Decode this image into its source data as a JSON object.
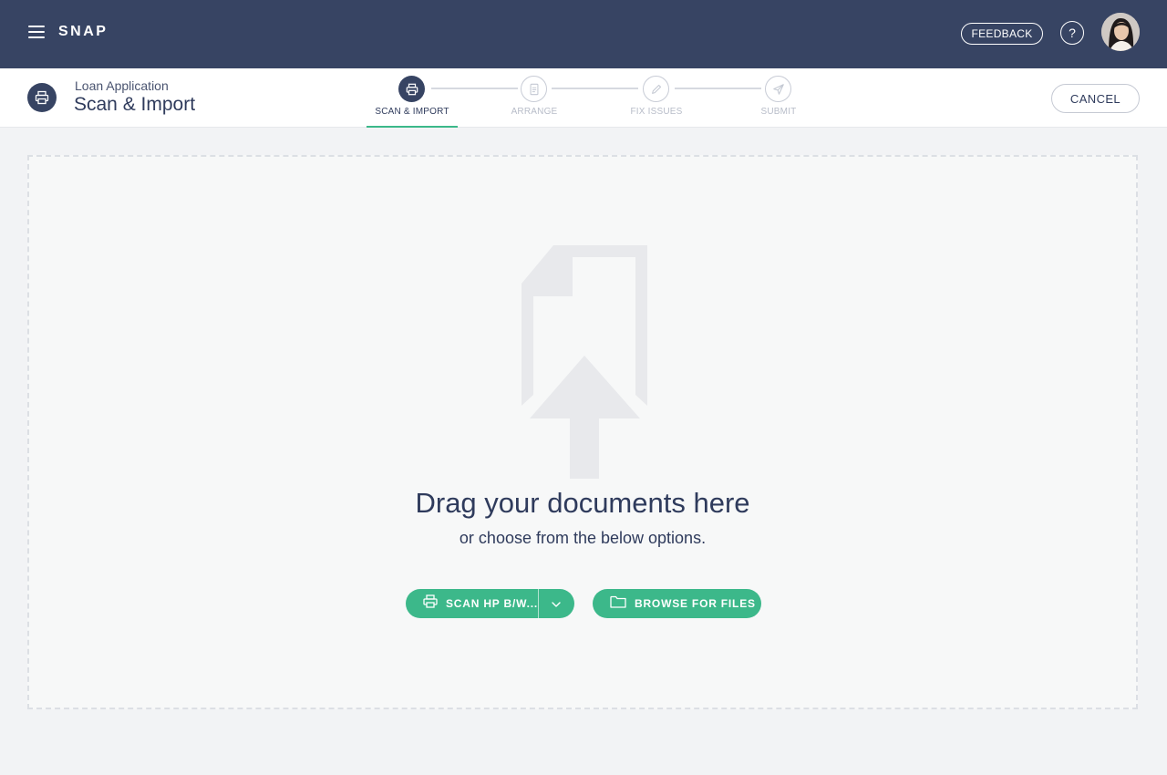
{
  "app": {
    "brand": "SNAP",
    "feedback_label": "FEEDBACK",
    "help_label": "?"
  },
  "header": {
    "subtitle": "Loan Application",
    "title": "Scan & Import",
    "cancel_label": "CANCEL"
  },
  "steps": [
    {
      "label": "SCAN & IMPORT",
      "icon": "printer-icon",
      "state": "active"
    },
    {
      "label": "ARRANGE",
      "icon": "document-icon",
      "state": "inactive"
    },
    {
      "label": "FIX ISSUES",
      "icon": "pencil-icon",
      "state": "inactive"
    },
    {
      "label": "SUBMIT",
      "icon": "send-icon",
      "state": "inactive"
    }
  ],
  "dropzone": {
    "title": "Drag your documents here",
    "subtitle": "or choose from the below options.",
    "scan_label": "SCAN HP B/W...",
    "browse_label": "BROWSE FOR FILES"
  },
  "colors": {
    "navy": "#374463",
    "accent_green": "#3cb88a"
  }
}
